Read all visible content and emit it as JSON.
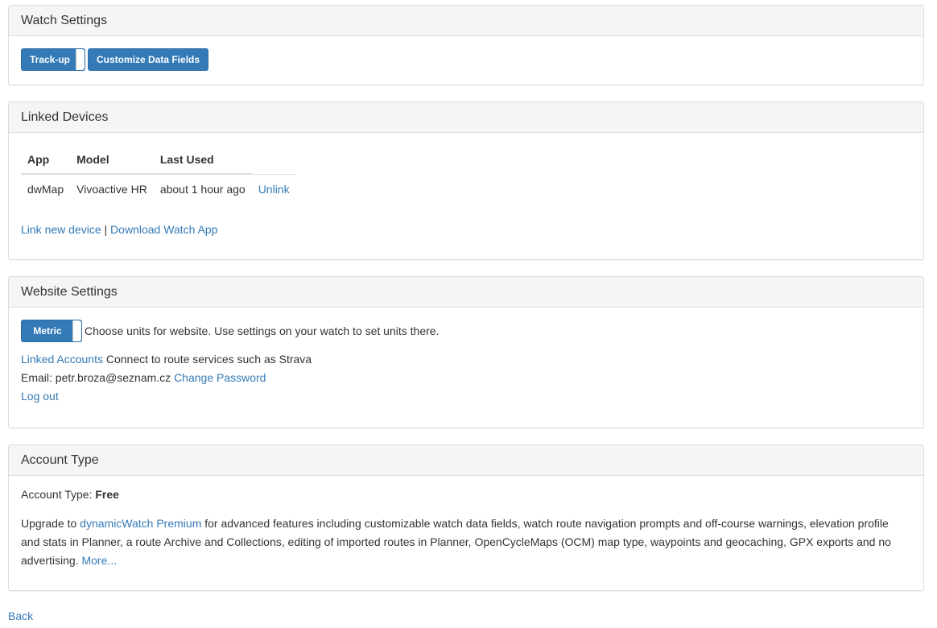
{
  "watch_settings": {
    "title": "Watch Settings",
    "orientation_toggle": "Track-up",
    "customize_button": "Customize Data Fields"
  },
  "linked_devices": {
    "title": "Linked Devices",
    "columns": [
      "App",
      "Model",
      "Last Used"
    ],
    "rows": [
      {
        "app": "dwMap",
        "model": "Vivoactive HR",
        "last_used": "about 1 hour ago",
        "action": "Unlink"
      }
    ],
    "link_new": "Link new device",
    "separator": "|",
    "download": "Download Watch App"
  },
  "website_settings": {
    "title": "Website Settings",
    "units_toggle": "Metric",
    "units_help": "Choose units for website. Use settings on your watch to set units there.",
    "linked_accounts_link": "Linked Accounts",
    "linked_accounts_text": "Connect to route services such as Strava",
    "email_label": "Email: petr.broza@seznam.cz",
    "change_password": "Change Password",
    "logout": "Log out"
  },
  "account_type": {
    "title": "Account Type",
    "label": "Account Type:",
    "value": "Free",
    "upgrade_prefix": "Upgrade to",
    "premium_link": "dynamicWatch Premium",
    "upgrade_text": "for advanced features including customizable watch data fields, watch route navigation prompts and off-course warnings, elevation profile and stats in Planner, a route Archive and Collections, editing of imported routes in Planner, OpenCycleMaps (OCM) map type, waypoints and geocaching, GPX exports and no advertising.",
    "more_link": "More..."
  },
  "back_link": "Back"
}
